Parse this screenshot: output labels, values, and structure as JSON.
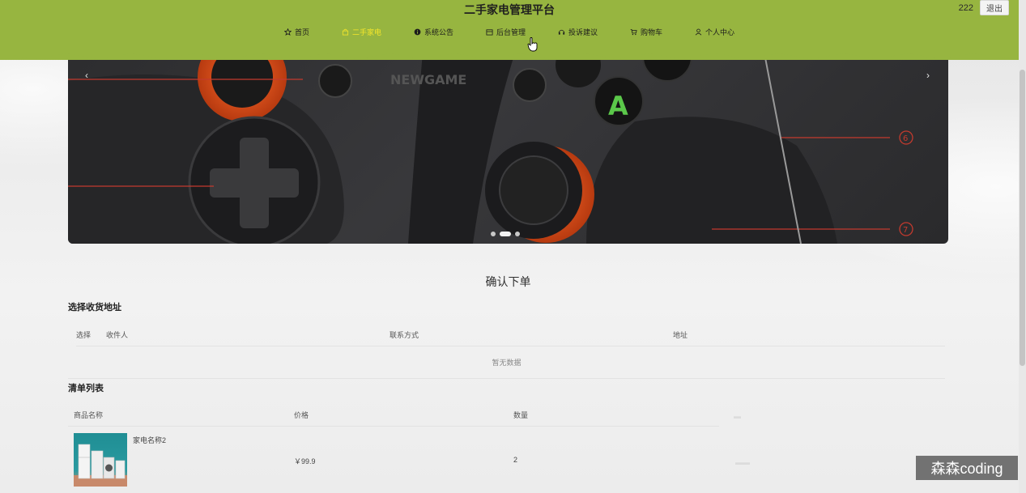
{
  "header": {
    "title": "二手家电管理平台",
    "username": "222",
    "logout_label": "退出",
    "nav": [
      {
        "label": "首页",
        "icon": "star-icon"
      },
      {
        "label": "二手家电",
        "icon": "bag-icon"
      },
      {
        "label": "系统公告",
        "icon": "info-icon"
      },
      {
        "label": "后台管理",
        "icon": "box-icon"
      },
      {
        "label": "投诉建议",
        "icon": "headset-icon"
      },
      {
        "label": "购物车",
        "icon": "cart-icon"
      },
      {
        "label": "个人中心",
        "icon": "user-icon"
      }
    ],
    "active_nav": "二手家电",
    "colors": {
      "bar": "#97b540",
      "active_text": "#f5e62a"
    }
  },
  "banner": {
    "prev_icon": "chevron-left-icon",
    "next_icon": "chevron-right-icon",
    "brand_text": "NEWGAME",
    "button_a": "A",
    "callouts": [
      "6",
      "7"
    ],
    "dots": [
      false,
      true,
      false
    ]
  },
  "page": {
    "confirm_title": "确认下单",
    "address_section": "选择收货地址",
    "address_columns": [
      "选择",
      "收件人",
      "联系方式",
      "地址"
    ],
    "empty_text": "暂无数据",
    "list_section": "清单列表",
    "list_columns": [
      "商品名称",
      "价格",
      "数量"
    ],
    "items": [
      {
        "name": "家电名称2",
        "price": "￥99.9",
        "quantity": "2"
      }
    ]
  },
  "watermark": "森森coding"
}
